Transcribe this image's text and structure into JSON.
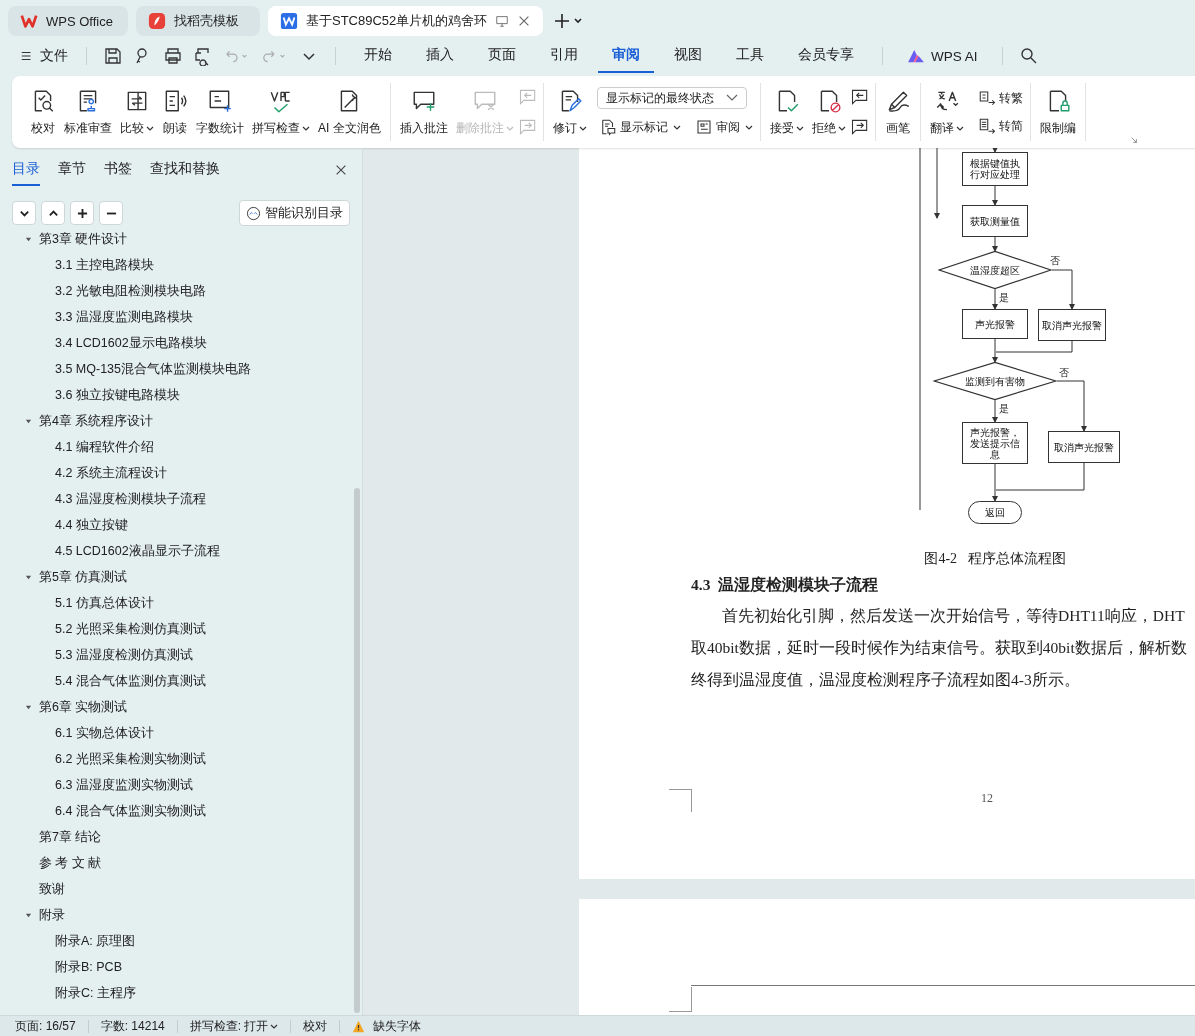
{
  "app_tabs": [
    {
      "kind": "wps",
      "label": "WPS Office",
      "selected": false
    },
    {
      "kind": "docer",
      "label": "找稻壳模板",
      "selected": false
    },
    {
      "kind": "doc",
      "label": "基于STC89C52单片机的鸡舍环",
      "selected": true
    }
  ],
  "menu": {
    "file": "文件",
    "tabs": [
      {
        "label": "开始",
        "selected": false
      },
      {
        "label": "插入",
        "selected": false
      },
      {
        "label": "页面",
        "selected": false
      },
      {
        "label": "引用",
        "selected": false
      },
      {
        "label": "审阅",
        "selected": true
      },
      {
        "label": "视图",
        "selected": false
      },
      {
        "label": "工具",
        "selected": false
      },
      {
        "label": "会员专享",
        "selected": false
      }
    ],
    "ai": "WPS AI"
  },
  "ribbon": {
    "groups": [
      {
        "items": [
          {
            "kind": "large",
            "label": "校对",
            "dropdown": false,
            "disabled": false
          },
          {
            "kind": "large",
            "label": "标准审查",
            "dropdown": false,
            "disabled": false
          },
          {
            "kind": "large",
            "label": "比较",
            "dropdown": true,
            "disabled": false
          },
          {
            "kind": "large",
            "label": "朗读",
            "dropdown": false,
            "disabled": false
          },
          {
            "kind": "large",
            "label": "字数统计",
            "dropdown": false,
            "disabled": false
          },
          {
            "kind": "large",
            "label": "拼写检查",
            "dropdown": true,
            "disabled": false
          },
          {
            "kind": "large",
            "label": "AI 全文润色",
            "dropdown": false,
            "disabled": false
          }
        ]
      },
      {
        "items": [
          {
            "kind": "large",
            "label": "插入批注",
            "dropdown": false,
            "disabled": false
          },
          {
            "kind": "large",
            "label": "删除批注",
            "dropdown": true,
            "disabled": true
          },
          {
            "kind": "icons",
            "disabled": true
          }
        ]
      },
      {
        "items": [
          {
            "kind": "large",
            "label": "修订",
            "dropdown": true,
            "disabled": false
          },
          {
            "kind": "select-stack",
            "value": "显示标记的最终状态",
            "buttons": [
              {
                "label": "显示标记",
                "dropdown": true
              },
              {
                "label": "审阅",
                "dropdown": true
              }
            ]
          }
        ]
      },
      {
        "items": [
          {
            "kind": "large",
            "label": "接受",
            "dropdown": true,
            "disabled": false
          },
          {
            "kind": "large",
            "label": "拒绝",
            "dropdown": true,
            "disabled": false
          },
          {
            "kind": "icons",
            "disabled": false
          }
        ]
      },
      {
        "items": [
          {
            "kind": "large",
            "label": "画笔",
            "dropdown": false,
            "disabled": false
          }
        ]
      },
      {
        "items": [
          {
            "kind": "large",
            "label": "翻译",
            "dropdown": true,
            "disabled": false
          },
          {
            "kind": "text-stack",
            "buttons": [
              {
                "label": "转繁"
              },
              {
                "label": "转简"
              }
            ]
          }
        ]
      },
      {
        "items": [
          {
            "kind": "large",
            "label": "限制编",
            "dropdown": false,
            "disabled": false
          }
        ]
      }
    ]
  },
  "nav_panel": {
    "tabs": [
      {
        "label": "目录",
        "selected": true
      },
      {
        "label": "章节",
        "selected": false
      },
      {
        "label": "书签",
        "selected": false
      },
      {
        "label": "查找和替换",
        "selected": false
      }
    ],
    "smart_button": "智能识别目录",
    "toc": [
      {
        "label": "第3章 硬件设计",
        "expanded": true,
        "children": [
          {
            "label": "3.1 主控电路模块"
          },
          {
            "label": "3.2 光敏电阻检测模块电路"
          },
          {
            "label": "3.3 温湿度监测电路模块"
          },
          {
            "label": "3.4 LCD1602显示电路模块"
          },
          {
            "label": "3.5 MQ-135混合气体监测模块电路"
          },
          {
            "label": "3.6 独立按键电路模块"
          }
        ]
      },
      {
        "label": "第4章 系统程序设计",
        "expanded": true,
        "children": [
          {
            "label": "4.1 编程软件介绍"
          },
          {
            "label": "4.2 系统主流程设计"
          },
          {
            "label": "4.3 温湿度检测模块子流程"
          },
          {
            "label": "4.4 独立按键"
          },
          {
            "label": "4.5 LCD1602液晶显示子流程"
          }
        ]
      },
      {
        "label": "第5章 仿真测试",
        "expanded": true,
        "children": [
          {
            "label": "5.1 仿真总体设计"
          },
          {
            "label": "5.2 光照采集检测仿真测试"
          },
          {
            "label": "5.3 温湿度检测仿真测试"
          },
          {
            "label": "5.4 混合气体监测仿真测试"
          }
        ]
      },
      {
        "label": "第6章 实物测试",
        "expanded": true,
        "children": [
          {
            "label": "6.1 实物总体设计"
          },
          {
            "label": "6.2 光照采集检测实物测试"
          },
          {
            "label": "6.3 温湿度监测实物测试"
          },
          {
            "label": "6.4 混合气体监测实物测试"
          }
        ]
      },
      {
        "label": "第7章 结论"
      },
      {
        "label": "参 考 文 献"
      },
      {
        "label": "致谢"
      },
      {
        "label": "附录",
        "expanded": true,
        "children": [
          {
            "label": "附录A: 原理图"
          },
          {
            "label": "附录B: PCB"
          },
          {
            "label": "附录C: 主程序"
          }
        ]
      }
    ]
  },
  "document": {
    "flowchart": {
      "nodes": [
        {
          "kind": "process",
          "text": "根据键值执行对应处理"
        },
        {
          "kind": "process",
          "text": "获取测量值"
        },
        {
          "kind": "decision",
          "text": "温湿度超区"
        },
        {
          "kind": "process",
          "text": "声光报警"
        },
        {
          "kind": "process",
          "text": "取消声光报警"
        },
        {
          "kind": "decision",
          "text": "监测到有害物"
        },
        {
          "kind": "process",
          "text": "声光报警，发送提示信息"
        },
        {
          "kind": "process",
          "text": "取消声光报警"
        },
        {
          "kind": "terminal",
          "text": "返回"
        }
      ],
      "labels": [
        "否",
        "是",
        "否",
        "是"
      ]
    },
    "caption": "图4-2   程序总体流程图",
    "heading": "4.3  温湿度检测模块子流程",
    "paragraph_lines": [
      "首先初始化引脚，然后发送一次开始信号，等待DHT11响应，DHT",
      "取40bit数据，延时一段时候作为结束信号。获取到40bit数据后，解析数",
      "终得到温湿度值，温湿度检测程序子流程如图4-3所示。"
    ],
    "page_number": "12"
  },
  "status_bar": {
    "page": "页面: 16/57",
    "words": "字数: 14214",
    "spell": "拼写检查: 打开",
    "proofread": "校对",
    "missing_fonts": "缺失字体"
  }
}
